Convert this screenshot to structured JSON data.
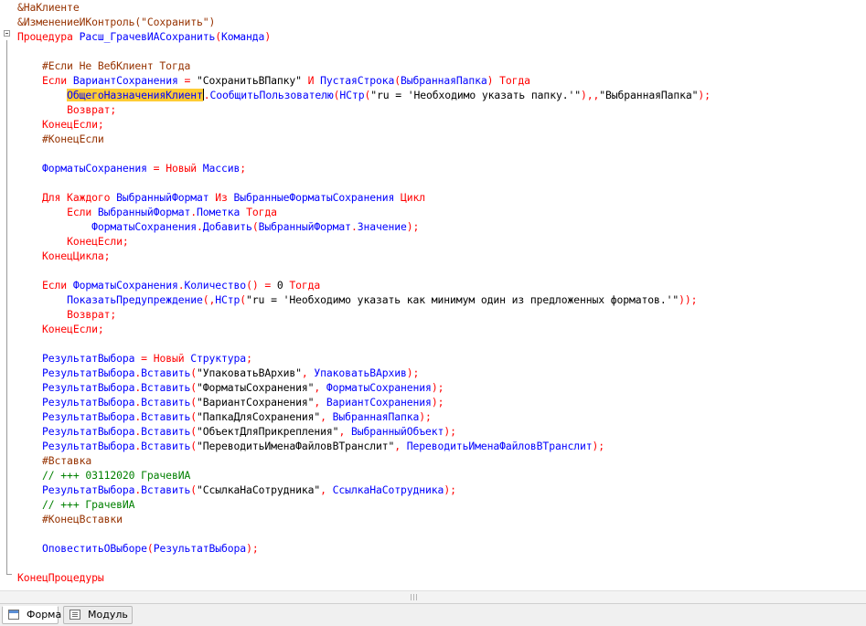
{
  "editor": {
    "lines": [
      {
        "indent": "",
        "tokens": [
          {
            "t": "&НаКлиенте",
            "c": "dir"
          }
        ]
      },
      {
        "indent": "",
        "tokens": [
          {
            "t": "&ИзменениеИКонтроль(\"Сохранить\")",
            "c": "dir"
          }
        ]
      },
      {
        "indent": "",
        "tokens": [
          {
            "t": "Процедура ",
            "c": "kw"
          },
          {
            "t": "Расш_ГрачевИАСохранить",
            "c": "id"
          },
          {
            "t": "(",
            "c": "op"
          },
          {
            "t": "Команда",
            "c": "id"
          },
          {
            "t": ")",
            "c": "op"
          }
        ]
      },
      {
        "indent": "",
        "tokens": []
      },
      {
        "indent": "    ",
        "tokens": [
          {
            "t": "#Если Не ВебКлиент Тогда",
            "c": "dir"
          }
        ]
      },
      {
        "indent": "    ",
        "tokens": [
          {
            "t": "Если ",
            "c": "kw"
          },
          {
            "t": "ВариантСохранения",
            "c": "id"
          },
          {
            "t": " = ",
            "c": "op"
          },
          {
            "t": "\"СохранитьВПапку\"",
            "c": "str"
          },
          {
            "t": " И ",
            "c": "kw"
          },
          {
            "t": "ПустаяСтрока",
            "c": "id"
          },
          {
            "t": "(",
            "c": "op"
          },
          {
            "t": "ВыбраннаяПапка",
            "c": "id"
          },
          {
            "t": ") ",
            "c": "op"
          },
          {
            "t": "Тогда",
            "c": "kw"
          }
        ]
      },
      {
        "indent": "        ",
        "tokens": [
          {
            "t": "ОбщегоНазначенияКлиент",
            "c": "hl"
          },
          {
            "t": "",
            "c": "caret"
          },
          {
            "t": ".",
            "c": "op"
          },
          {
            "t": "СообщитьПользователю",
            "c": "id"
          },
          {
            "t": "(",
            "c": "op"
          },
          {
            "t": "НСтр",
            "c": "id"
          },
          {
            "t": "(",
            "c": "op"
          },
          {
            "t": "\"ru = 'Необходимо указать папку.'\"",
            "c": "str"
          },
          {
            "t": "),,",
            "c": "op"
          },
          {
            "t": "\"ВыбраннаяПапка\"",
            "c": "str"
          },
          {
            "t": ");",
            "c": "op"
          }
        ]
      },
      {
        "indent": "        ",
        "tokens": [
          {
            "t": "Возврат;",
            "c": "kw"
          }
        ]
      },
      {
        "indent": "    ",
        "tokens": [
          {
            "t": "КонецЕсли;",
            "c": "kw"
          }
        ]
      },
      {
        "indent": "    ",
        "tokens": [
          {
            "t": "#КонецЕсли",
            "c": "dir"
          }
        ]
      },
      {
        "indent": "",
        "tokens": []
      },
      {
        "indent": "    ",
        "tokens": [
          {
            "t": "ФорматыСохранения",
            "c": "id"
          },
          {
            "t": " = ",
            "c": "op"
          },
          {
            "t": "Новый ",
            "c": "kw"
          },
          {
            "t": "Массив",
            "c": "id"
          },
          {
            "t": ";",
            "c": "op"
          }
        ]
      },
      {
        "indent": "",
        "tokens": []
      },
      {
        "indent": "    ",
        "tokens": [
          {
            "t": "Для Каждого ",
            "c": "kw"
          },
          {
            "t": "ВыбранныйФормат",
            "c": "id"
          },
          {
            "t": " Из ",
            "c": "kw"
          },
          {
            "t": "ВыбранныеФорматыСохранения",
            "c": "id"
          },
          {
            "t": " Цикл",
            "c": "kw"
          }
        ]
      },
      {
        "indent": "        ",
        "tokens": [
          {
            "t": "Если ",
            "c": "kw"
          },
          {
            "t": "ВыбранныйФормат",
            "c": "id"
          },
          {
            "t": ".",
            "c": "op"
          },
          {
            "t": "Пометка",
            "c": "id"
          },
          {
            "t": " Тогда",
            "c": "kw"
          }
        ]
      },
      {
        "indent": "            ",
        "tokens": [
          {
            "t": "ФорматыСохранения",
            "c": "id"
          },
          {
            "t": ".",
            "c": "op"
          },
          {
            "t": "Добавить",
            "c": "id"
          },
          {
            "t": "(",
            "c": "op"
          },
          {
            "t": "ВыбранныйФормат",
            "c": "id"
          },
          {
            "t": ".",
            "c": "op"
          },
          {
            "t": "Значение",
            "c": "id"
          },
          {
            "t": ");",
            "c": "op"
          }
        ]
      },
      {
        "indent": "        ",
        "tokens": [
          {
            "t": "КонецЕсли;",
            "c": "kw"
          }
        ]
      },
      {
        "indent": "    ",
        "tokens": [
          {
            "t": "КонецЦикла;",
            "c": "kw"
          }
        ]
      },
      {
        "indent": "",
        "tokens": []
      },
      {
        "indent": "    ",
        "tokens": [
          {
            "t": "Если ",
            "c": "kw"
          },
          {
            "t": "ФорматыСохранения",
            "c": "id"
          },
          {
            "t": ".",
            "c": "op"
          },
          {
            "t": "Количество",
            "c": "id"
          },
          {
            "t": "() = ",
            "c": "op"
          },
          {
            "t": "0",
            "c": "str"
          },
          {
            "t": " Тогда",
            "c": "kw"
          }
        ]
      },
      {
        "indent": "        ",
        "tokens": [
          {
            "t": "ПоказатьПредупреждение",
            "c": "id"
          },
          {
            "t": "(,",
            "c": "op"
          },
          {
            "t": "НСтр",
            "c": "id"
          },
          {
            "t": "(",
            "c": "op"
          },
          {
            "t": "\"ru = 'Необходимо указать как минимум один из предложенных форматов.'\"",
            "c": "str"
          },
          {
            "t": "));",
            "c": "op"
          }
        ]
      },
      {
        "indent": "        ",
        "tokens": [
          {
            "t": "Возврат;",
            "c": "kw"
          }
        ]
      },
      {
        "indent": "    ",
        "tokens": [
          {
            "t": "КонецЕсли;",
            "c": "kw"
          }
        ]
      },
      {
        "indent": "",
        "tokens": []
      },
      {
        "indent": "    ",
        "tokens": [
          {
            "t": "РезультатВыбора",
            "c": "id"
          },
          {
            "t": " = ",
            "c": "op"
          },
          {
            "t": "Новый ",
            "c": "kw"
          },
          {
            "t": "Структура",
            "c": "id"
          },
          {
            "t": ";",
            "c": "op"
          }
        ]
      },
      {
        "indent": "    ",
        "tokens": [
          {
            "t": "РезультатВыбора",
            "c": "id"
          },
          {
            "t": ".",
            "c": "op"
          },
          {
            "t": "Вставить",
            "c": "id"
          },
          {
            "t": "(",
            "c": "op"
          },
          {
            "t": "\"УпаковатьВАрхив\"",
            "c": "str"
          },
          {
            "t": ", ",
            "c": "op"
          },
          {
            "t": "УпаковатьВАрхив",
            "c": "id"
          },
          {
            "t": ");",
            "c": "op"
          }
        ]
      },
      {
        "indent": "    ",
        "tokens": [
          {
            "t": "РезультатВыбора",
            "c": "id"
          },
          {
            "t": ".",
            "c": "op"
          },
          {
            "t": "Вставить",
            "c": "id"
          },
          {
            "t": "(",
            "c": "op"
          },
          {
            "t": "\"ФорматыСохранения\"",
            "c": "str"
          },
          {
            "t": ", ",
            "c": "op"
          },
          {
            "t": "ФорматыСохранения",
            "c": "id"
          },
          {
            "t": ");",
            "c": "op"
          }
        ]
      },
      {
        "indent": "    ",
        "tokens": [
          {
            "t": "РезультатВыбора",
            "c": "id"
          },
          {
            "t": ".",
            "c": "op"
          },
          {
            "t": "Вставить",
            "c": "id"
          },
          {
            "t": "(",
            "c": "op"
          },
          {
            "t": "\"ВариантСохранения\"",
            "c": "str"
          },
          {
            "t": ", ",
            "c": "op"
          },
          {
            "t": "ВариантСохранения",
            "c": "id"
          },
          {
            "t": ");",
            "c": "op"
          }
        ]
      },
      {
        "indent": "    ",
        "tokens": [
          {
            "t": "РезультатВыбора",
            "c": "id"
          },
          {
            "t": ".",
            "c": "op"
          },
          {
            "t": "Вставить",
            "c": "id"
          },
          {
            "t": "(",
            "c": "op"
          },
          {
            "t": "\"ПапкаДляСохранения\"",
            "c": "str"
          },
          {
            "t": ", ",
            "c": "op"
          },
          {
            "t": "ВыбраннаяПапка",
            "c": "id"
          },
          {
            "t": ");",
            "c": "op"
          }
        ]
      },
      {
        "indent": "    ",
        "tokens": [
          {
            "t": "РезультатВыбора",
            "c": "id"
          },
          {
            "t": ".",
            "c": "op"
          },
          {
            "t": "Вставить",
            "c": "id"
          },
          {
            "t": "(",
            "c": "op"
          },
          {
            "t": "\"ОбъектДляПрикрепления\"",
            "c": "str"
          },
          {
            "t": ", ",
            "c": "op"
          },
          {
            "t": "ВыбранныйОбъект",
            "c": "id"
          },
          {
            "t": ");",
            "c": "op"
          }
        ]
      },
      {
        "indent": "    ",
        "tokens": [
          {
            "t": "РезультатВыбора",
            "c": "id"
          },
          {
            "t": ".",
            "c": "op"
          },
          {
            "t": "Вставить",
            "c": "id"
          },
          {
            "t": "(",
            "c": "op"
          },
          {
            "t": "\"ПереводитьИменаФайловВТранслит\"",
            "c": "str"
          },
          {
            "t": ", ",
            "c": "op"
          },
          {
            "t": "ПереводитьИменаФайловВТранслит",
            "c": "id"
          },
          {
            "t": ");",
            "c": "op"
          }
        ]
      },
      {
        "indent": "    ",
        "tokens": [
          {
            "t": "#Вставка",
            "c": "dir"
          }
        ]
      },
      {
        "indent": "    ",
        "tokens": [
          {
            "t": "// +++ 03112020 ГрачевИА",
            "c": "cm"
          }
        ]
      },
      {
        "indent": "    ",
        "tokens": [
          {
            "t": "РезультатВыбора",
            "c": "id"
          },
          {
            "t": ".",
            "c": "op"
          },
          {
            "t": "Вставить",
            "c": "id"
          },
          {
            "t": "(",
            "c": "op"
          },
          {
            "t": "\"СсылкаНаСотрудника\"",
            "c": "str"
          },
          {
            "t": ", ",
            "c": "op"
          },
          {
            "t": "СсылкаНаСотрудника",
            "c": "id"
          },
          {
            "t": ");",
            "c": "op"
          }
        ]
      },
      {
        "indent": "    ",
        "tokens": [
          {
            "t": "// +++ ГрачевИА",
            "c": "cm"
          }
        ]
      },
      {
        "indent": "    ",
        "tokens": [
          {
            "t": "#КонецВставки",
            "c": "dir"
          }
        ]
      },
      {
        "indent": "",
        "tokens": []
      },
      {
        "indent": "    ",
        "tokens": [
          {
            "t": "ОповеститьОВыборе",
            "c": "id"
          },
          {
            "t": "(",
            "c": "op"
          },
          {
            "t": "РезультатВыбора",
            "c": "id"
          },
          {
            "t": ");",
            "c": "op"
          }
        ]
      },
      {
        "indent": "",
        "tokens": []
      },
      {
        "indent": "",
        "tokens": [
          {
            "t": "КонецПроцедуры",
            "c": "kw"
          }
        ]
      }
    ]
  },
  "tabs": [
    {
      "label": "Форма",
      "icon": "form-icon",
      "active": true
    },
    {
      "label": "Модуль",
      "icon": "module-icon",
      "active": false
    }
  ],
  "colors": {
    "keyword": "#ff0000",
    "identifier": "#0000ff",
    "preprocessor": "#963200",
    "comment": "#008000",
    "highlight": "#ffcc33"
  }
}
